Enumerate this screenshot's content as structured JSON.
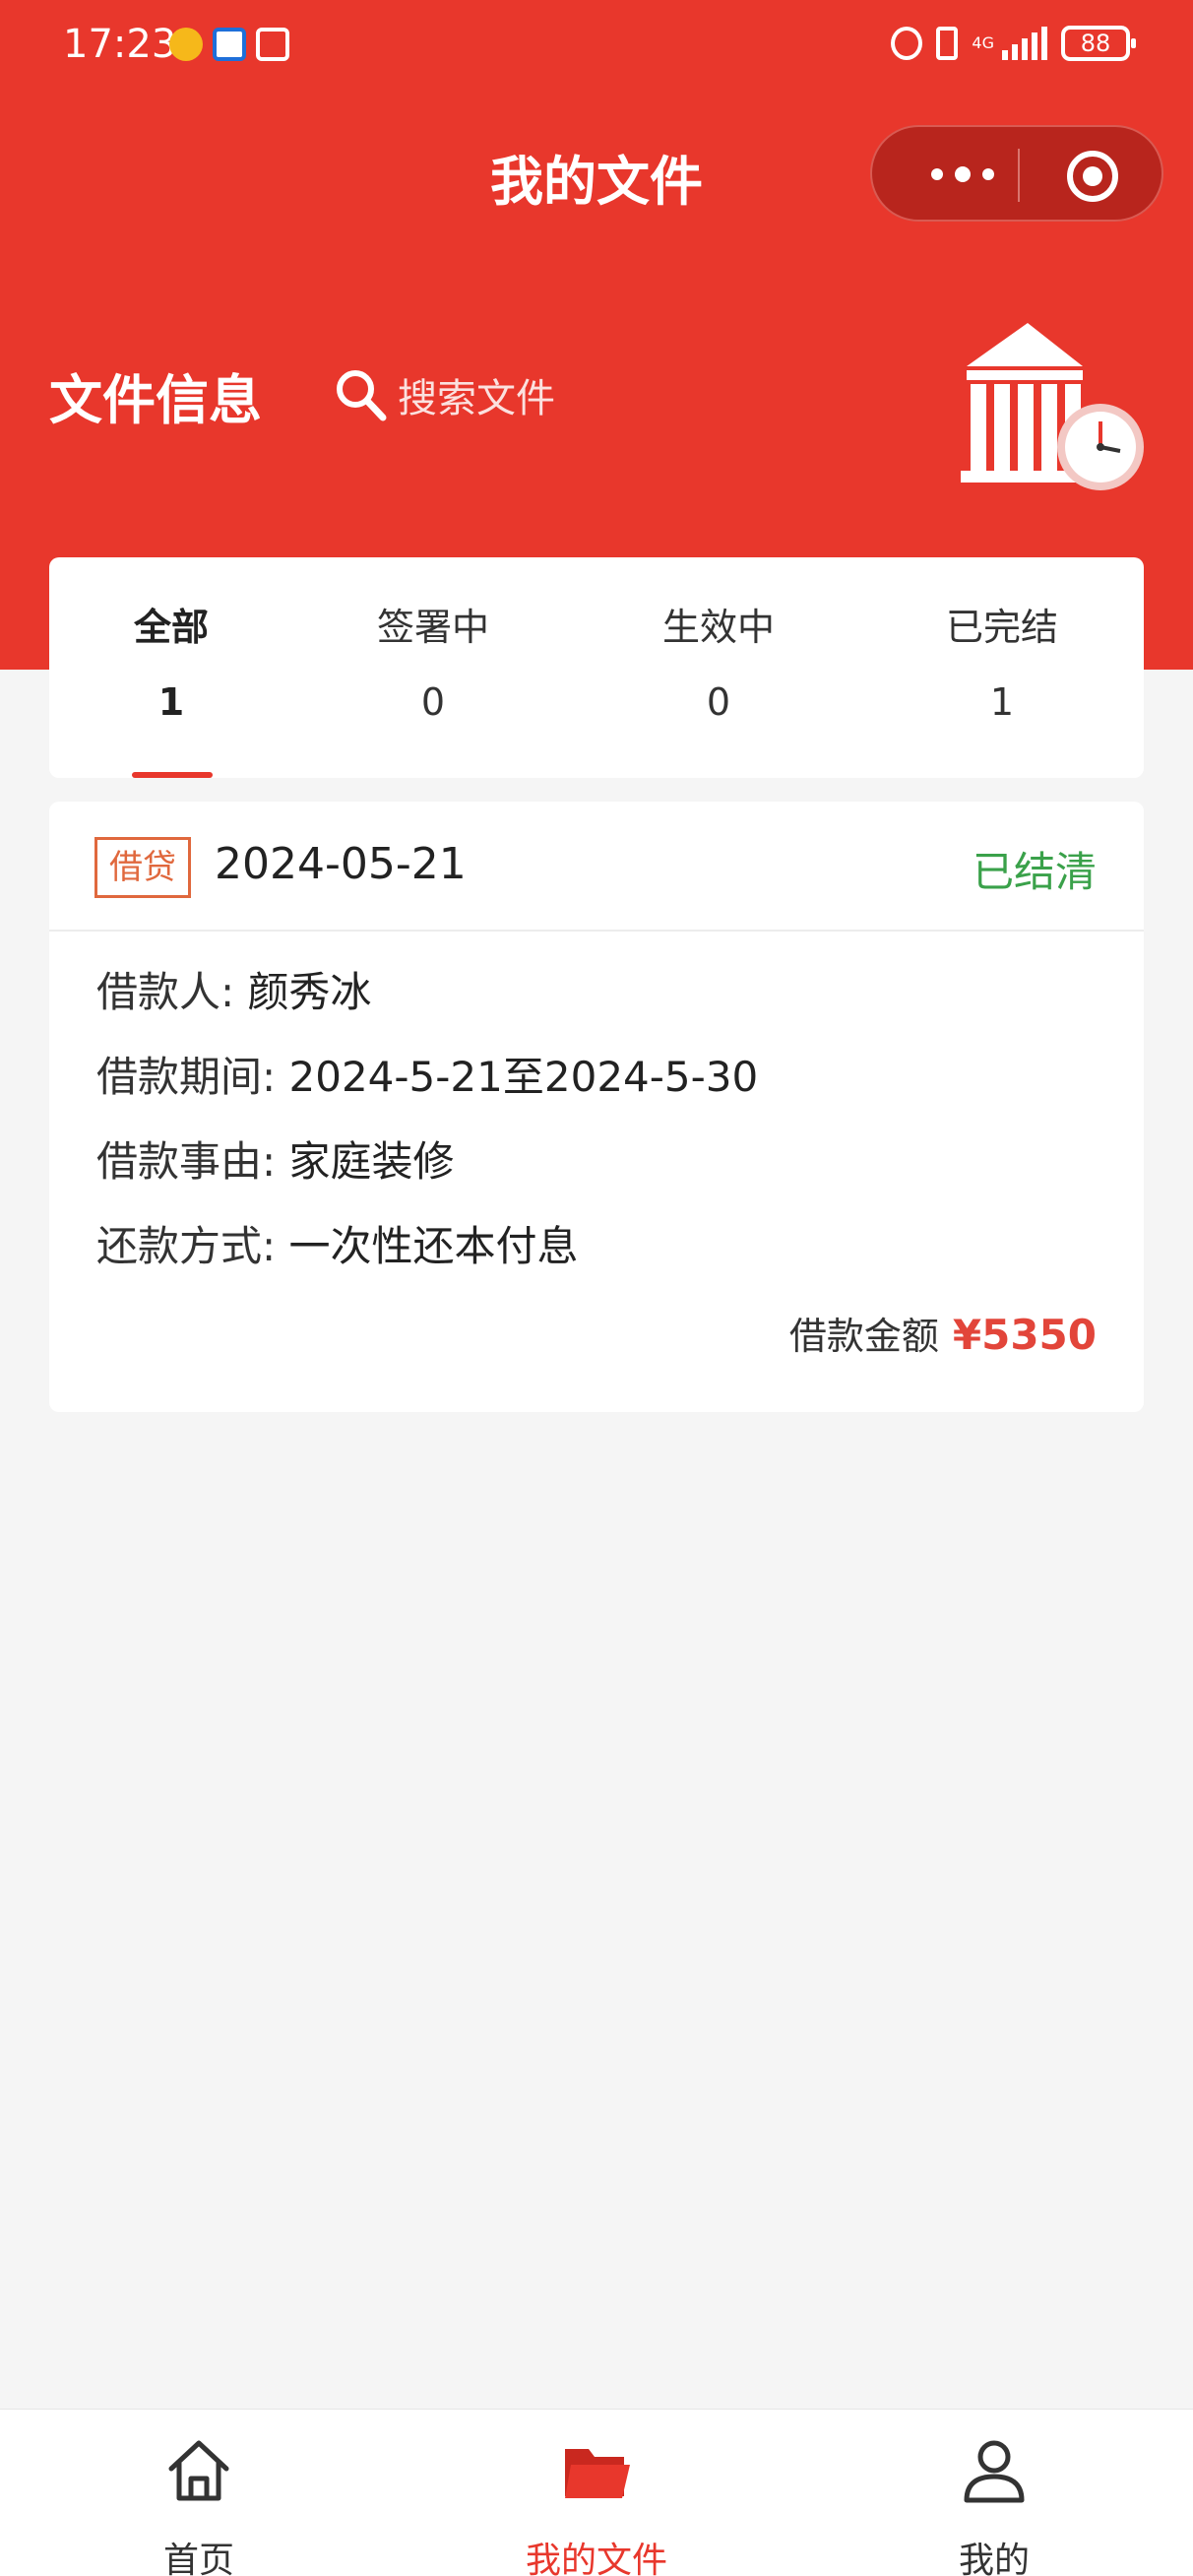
{
  "status_bar": {
    "time": "17:23",
    "battery": "88",
    "network": "4G"
  },
  "nav": {
    "title": "我的文件"
  },
  "header": {
    "section_title": "文件信息",
    "search_placeholder": "搜索文件"
  },
  "tabs": [
    {
      "label": "全部",
      "count": "1",
      "active": true
    },
    {
      "label": "签署中",
      "count": "0",
      "active": false
    },
    {
      "label": "生效中",
      "count": "0",
      "active": false
    },
    {
      "label": "已完结",
      "count": "1",
      "active": false
    }
  ],
  "record": {
    "type": "借贷",
    "date": "2024-05-21",
    "status": "已结清",
    "borrower_label": "借款人:",
    "borrower": "颜秀冰",
    "period_label": "借款期间:",
    "period": "2024-5-21至2024-5-30",
    "reason_label": "借款事由:",
    "reason": "家庭装修",
    "repay_label": "还款方式:",
    "repay": "一次性还本付息",
    "amount_label": "借款金额",
    "amount": "¥5350"
  },
  "tabbar": [
    {
      "label": "首页",
      "icon": "home-icon"
    },
    {
      "label": "我的文件",
      "icon": "folder-icon",
      "active": true
    },
    {
      "label": "我的",
      "icon": "user-icon"
    }
  ],
  "colors": {
    "brand_red": "#e8372c",
    "status_green": "#3aa14a",
    "amount_red": "#e2453a",
    "badge_orange": "#e0683d"
  }
}
